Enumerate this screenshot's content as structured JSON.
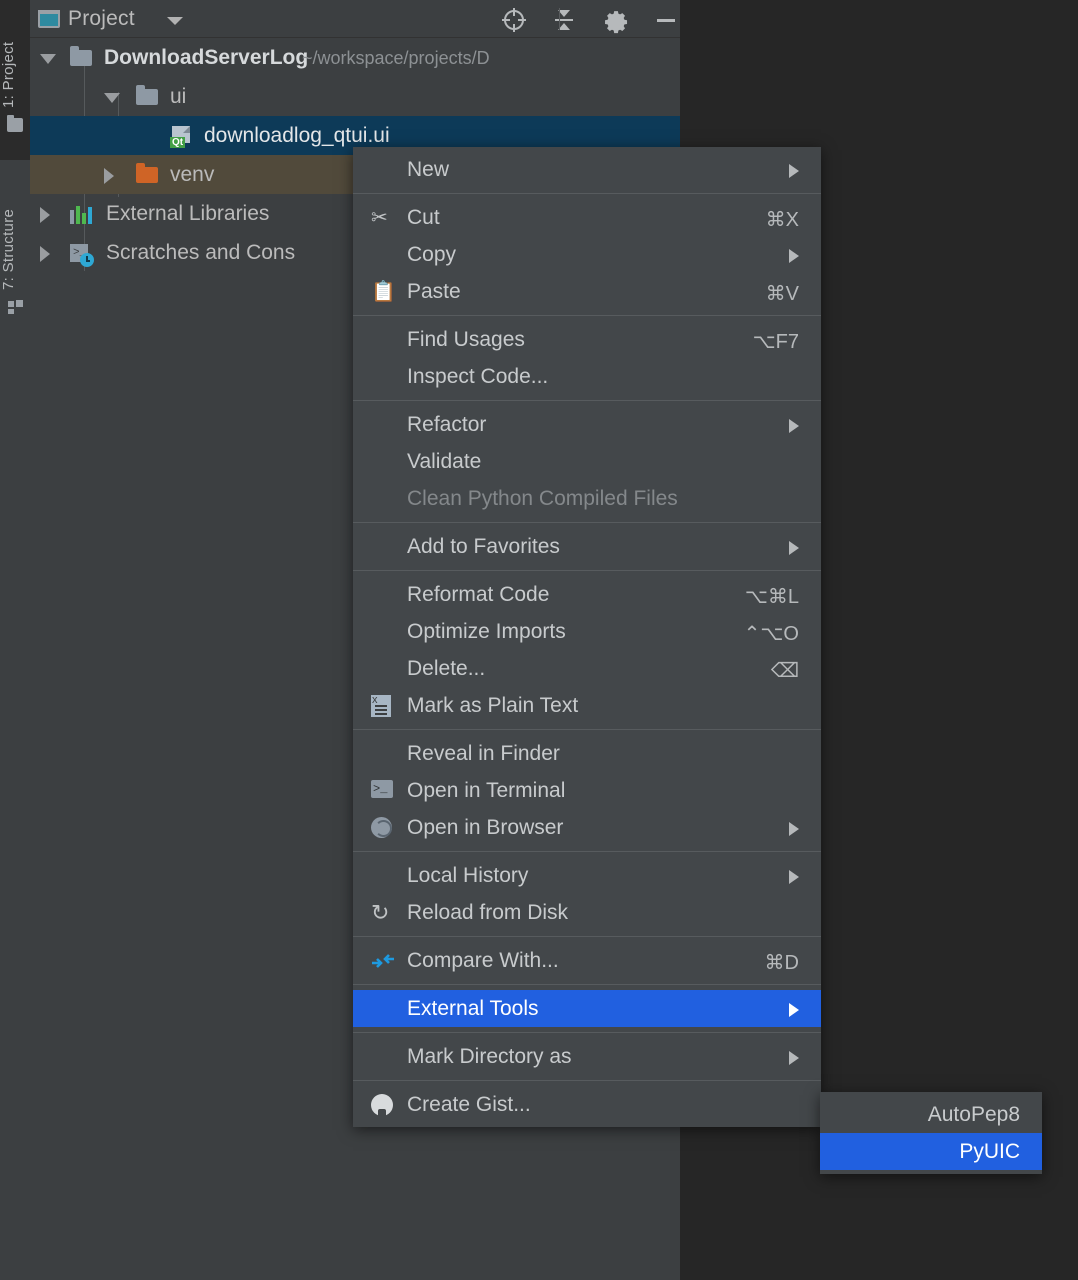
{
  "rail": {
    "project_label": "1: Project",
    "structure_label": "7: Structure",
    "project_icon": "folder-icon",
    "structure_icon": "structure-blocks-icon"
  },
  "panel": {
    "title": "Project",
    "title_icon": "project-window-icon",
    "dropdown_icon": "chevron-down-icon",
    "toolbar": [
      {
        "name": "locate-icon",
        "tooltip": "Select Opened File"
      },
      {
        "name": "collapse-all-icon",
        "tooltip": "Collapse All"
      },
      {
        "name": "gear-icon",
        "tooltip": "Settings"
      },
      {
        "name": "minimize-icon",
        "tooltip": "Hide"
      }
    ]
  },
  "tree": [
    {
      "label": "DownloadServerLog",
      "sub": "~/workspace/projects/D",
      "icon": "folder-icon",
      "twisty": "expanded",
      "indent": 0,
      "state": "normal"
    },
    {
      "label": "ui",
      "sub": "",
      "icon": "folder-icon",
      "twisty": "expanded",
      "indent": 1,
      "state": "normal"
    },
    {
      "label": "downloadlog_qtui.ui",
      "sub": "",
      "icon": "qt-ui-file-icon",
      "twisty": "none",
      "indent": 2,
      "state": "selected"
    },
    {
      "label": "venv",
      "sub": "",
      "icon": "folder-orange-icon",
      "twisty": "collapsed",
      "indent": 1,
      "state": "highlighted"
    },
    {
      "label": "External Libraries",
      "sub": "",
      "icon": "library-icon",
      "twisty": "collapsed",
      "indent": 0,
      "state": "normal"
    },
    {
      "label": "Scratches and Cons",
      "sub": "",
      "icon": "scratches-icon",
      "twisty": "collapsed",
      "indent": 0,
      "state": "normal"
    }
  ],
  "context_menu": {
    "groups": [
      {
        "items": [
          {
            "label": "New",
            "shortcut": "",
            "icon": "",
            "submenu": true,
            "disabled": false,
            "highlighted": false
          }
        ]
      },
      {
        "items": [
          {
            "label": "Cut",
            "shortcut": "⌘X",
            "icon": "scissors-icon",
            "submenu": false,
            "disabled": false,
            "highlighted": false
          },
          {
            "label": "Copy",
            "shortcut": "",
            "icon": "",
            "submenu": true,
            "disabled": false,
            "highlighted": false
          },
          {
            "label": "Paste",
            "shortcut": "⌘V",
            "icon": "clipboard-icon",
            "submenu": false,
            "disabled": false,
            "highlighted": false
          }
        ]
      },
      {
        "items": [
          {
            "label": "Find Usages",
            "shortcut": "⌥F7",
            "icon": "",
            "submenu": false,
            "disabled": false,
            "highlighted": false
          },
          {
            "label": "Inspect Code...",
            "shortcut": "",
            "icon": "",
            "submenu": false,
            "disabled": false,
            "highlighted": false
          }
        ]
      },
      {
        "items": [
          {
            "label": "Refactor",
            "shortcut": "",
            "icon": "",
            "submenu": true,
            "disabled": false,
            "highlighted": false
          },
          {
            "label": "Validate",
            "shortcut": "",
            "icon": "",
            "submenu": false,
            "disabled": false,
            "highlighted": false
          },
          {
            "label": "Clean Python Compiled Files",
            "shortcut": "",
            "icon": "",
            "submenu": false,
            "disabled": true,
            "highlighted": false
          }
        ]
      },
      {
        "items": [
          {
            "label": "Add to Favorites",
            "shortcut": "",
            "icon": "",
            "submenu": true,
            "disabled": false,
            "highlighted": false
          }
        ]
      },
      {
        "items": [
          {
            "label": "Reformat Code",
            "shortcut": "⌥⌘L",
            "icon": "",
            "submenu": false,
            "disabled": false,
            "highlighted": false
          },
          {
            "label": "Optimize Imports",
            "shortcut": "⌃⌥O",
            "icon": "",
            "submenu": false,
            "disabled": false,
            "highlighted": false
          },
          {
            "label": "Delete...",
            "shortcut": "⌫",
            "icon": "",
            "submenu": false,
            "disabled": false,
            "highlighted": false
          },
          {
            "label": "Mark as Plain Text",
            "shortcut": "",
            "icon": "plain-text-icon",
            "submenu": false,
            "disabled": false,
            "highlighted": false
          }
        ]
      },
      {
        "items": [
          {
            "label": "Reveal in Finder",
            "shortcut": "",
            "icon": "",
            "submenu": false,
            "disabled": false,
            "highlighted": false
          },
          {
            "label": "Open in Terminal",
            "shortcut": "",
            "icon": "terminal-icon",
            "submenu": false,
            "disabled": false,
            "highlighted": false
          },
          {
            "label": "Open in Browser",
            "shortcut": "",
            "icon": "globe-icon",
            "submenu": true,
            "disabled": false,
            "highlighted": false
          }
        ]
      },
      {
        "items": [
          {
            "label": "Local History",
            "shortcut": "",
            "icon": "",
            "submenu": true,
            "disabled": false,
            "highlighted": false
          },
          {
            "label": "Reload from Disk",
            "shortcut": "",
            "icon": "reload-icon",
            "submenu": false,
            "disabled": false,
            "highlighted": false
          }
        ]
      },
      {
        "items": [
          {
            "label": "Compare With...",
            "shortcut": "⌘D",
            "icon": "compare-icon",
            "submenu": false,
            "disabled": false,
            "highlighted": false
          }
        ]
      },
      {
        "items": [
          {
            "label": "External Tools",
            "shortcut": "",
            "icon": "",
            "submenu": true,
            "disabled": false,
            "highlighted": true
          }
        ]
      },
      {
        "items": [
          {
            "label": "Mark Directory as",
            "shortcut": "",
            "icon": "",
            "submenu": true,
            "disabled": false,
            "highlighted": false
          }
        ]
      },
      {
        "items": [
          {
            "label": "Create Gist...",
            "shortcut": "",
            "icon": "github-icon",
            "submenu": false,
            "disabled": false,
            "highlighted": false
          }
        ]
      }
    ]
  },
  "submenu": {
    "items": [
      {
        "label": "AutoPep8",
        "highlighted": false
      },
      {
        "label": "PyUIC",
        "highlighted": true
      }
    ]
  },
  "colors": {
    "panel_bg": "#3c3f41",
    "menu_bg": "#43474a",
    "accent_selection": "#2160e0",
    "tree_selected": "#0d3a58",
    "tree_highlight": "#514a3b",
    "text": "#c8cbcd",
    "text_dim": "#84888b",
    "qt_badge": "#43a047",
    "venv_folder": "#cf6426"
  }
}
